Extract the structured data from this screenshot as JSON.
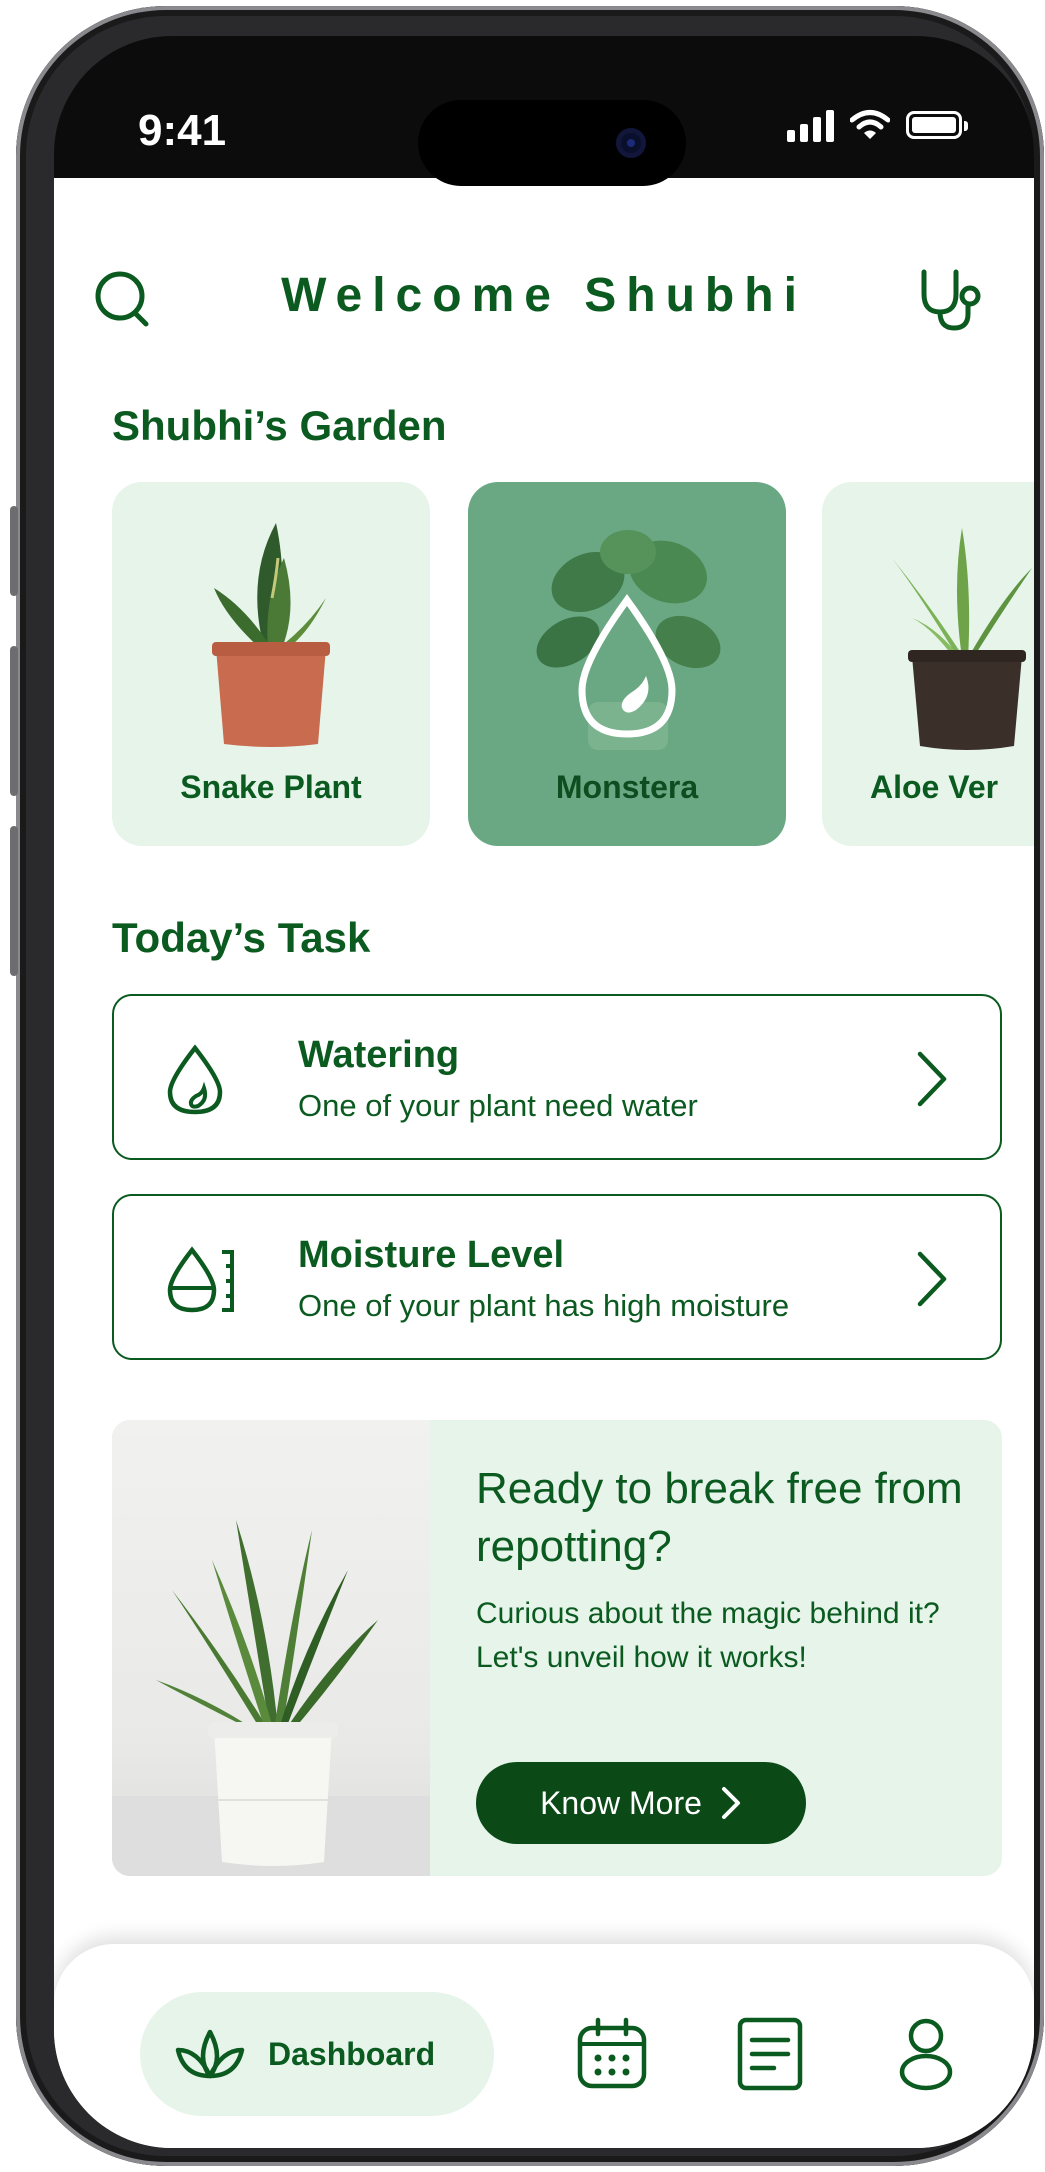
{
  "status_bar": {
    "time": "9:41"
  },
  "header": {
    "title": "Welcome Shubhi"
  },
  "garden": {
    "title": "Shubhi’s Garden",
    "plants": [
      {
        "name": "Snake Plant",
        "active": false
      },
      {
        "name": "Monstera",
        "active": true
      },
      {
        "name": "Aloe Ver",
        "active": false
      }
    ]
  },
  "tasks": {
    "title": "Today’s Task",
    "items": [
      {
        "title": "Watering",
        "subtitle": "One of your plant need water",
        "icon": "water-drop-icon"
      },
      {
        "title": "Moisture Level",
        "subtitle": "One of your plant has high moisture",
        "icon": "moisture-level-icon"
      }
    ]
  },
  "promo": {
    "title": "Ready to break free from repotting?",
    "description": "Curious about the magic behind it? Let's unveil how it works!",
    "button_label": "Know More"
  },
  "nav": {
    "dashboard_label": "Dashboard",
    "items": [
      "dashboard-icon",
      "calendar-icon",
      "notes-icon",
      "profile-icon"
    ]
  },
  "colors": {
    "primary": "#0b5a20",
    "dark_button": "#0b4a17",
    "light_card": "#e6f4ea",
    "active_card": "#6aa883"
  }
}
